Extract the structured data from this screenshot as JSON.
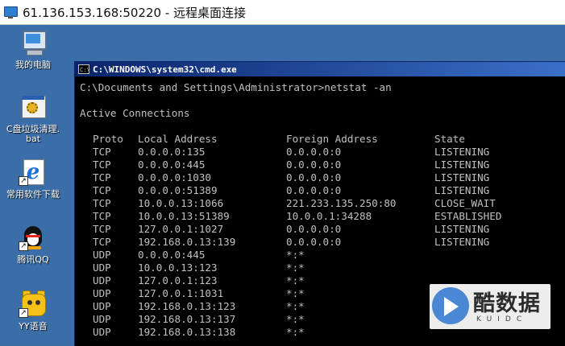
{
  "rdp": {
    "title": "61.136.153.168:50220 - 远程桌面连接",
    "icon": "remote-desktop-icon"
  },
  "desktop_icons": [
    {
      "label": "我的电脑",
      "icon": "my-computer-icon"
    },
    {
      "label": "C盘垃圾清理.\nbat",
      "icon": "batch-file-icon"
    },
    {
      "label": "常用软件下载",
      "icon": "internet-explorer-shortcut-icon"
    },
    {
      "label": "腾讯QQ",
      "icon": "qq-penguin-icon"
    },
    {
      "label": "YY语音",
      "icon": "yy-voice-icon"
    }
  ],
  "cmd": {
    "title": "C:\\WINDOWS\\system32\\cmd.exe",
    "icon_text": "C:\\",
    "prompt_line": "C:\\Documents and Settings\\Administrator>netstat -an",
    "section_title": "Active Connections",
    "headers": {
      "proto": "Proto",
      "local": "Local Address",
      "foreign": "Foreign Address",
      "state": "State"
    },
    "rows": [
      {
        "proto": "TCP",
        "local": "0.0.0.0:135",
        "foreign": "0.0.0.0:0",
        "state": "LISTENING"
      },
      {
        "proto": "TCP",
        "local": "0.0.0.0:445",
        "foreign": "0.0.0.0:0",
        "state": "LISTENING"
      },
      {
        "proto": "TCP",
        "local": "0.0.0.0:1030",
        "foreign": "0.0.0.0:0",
        "state": "LISTENING"
      },
      {
        "proto": "TCP",
        "local": "0.0.0.0:51389",
        "foreign": "0.0.0.0:0",
        "state": "LISTENING"
      },
      {
        "proto": "TCP",
        "local": "10.0.0.13:1066",
        "foreign": "221.233.135.250:80",
        "state": "CLOSE_WAIT"
      },
      {
        "proto": "TCP",
        "local": "10.0.0.13:51389",
        "foreign": "10.0.0.1:34288",
        "state": "ESTABLISHED"
      },
      {
        "proto": "TCP",
        "local": "127.0.0.1:1027",
        "foreign": "0.0.0.0:0",
        "state": "LISTENING"
      },
      {
        "proto": "TCP",
        "local": "192.168.0.13:139",
        "foreign": "0.0.0.0:0",
        "state": "LISTENING"
      },
      {
        "proto": "UDP",
        "local": "0.0.0.0:445",
        "foreign": "*:*",
        "state": ""
      },
      {
        "proto": "UDP",
        "local": "10.0.0.13:123",
        "foreign": "*:*",
        "state": ""
      },
      {
        "proto": "UDP",
        "local": "127.0.0.1:123",
        "foreign": "*:*",
        "state": ""
      },
      {
        "proto": "UDP",
        "local": "127.0.0.1:1031",
        "foreign": "*:*",
        "state": ""
      },
      {
        "proto": "UDP",
        "local": "192.168.0.13:123",
        "foreign": "*:*",
        "state": ""
      },
      {
        "proto": "UDP",
        "local": "192.168.0.13:137",
        "foreign": "*:*",
        "state": ""
      },
      {
        "proto": "UDP",
        "local": "192.168.0.13:138",
        "foreign": "*:*",
        "state": ""
      }
    ]
  },
  "watermark": {
    "text": "酷数据",
    "sub": "KUIDC",
    "icon": "kuidc-logo-icon"
  }
}
